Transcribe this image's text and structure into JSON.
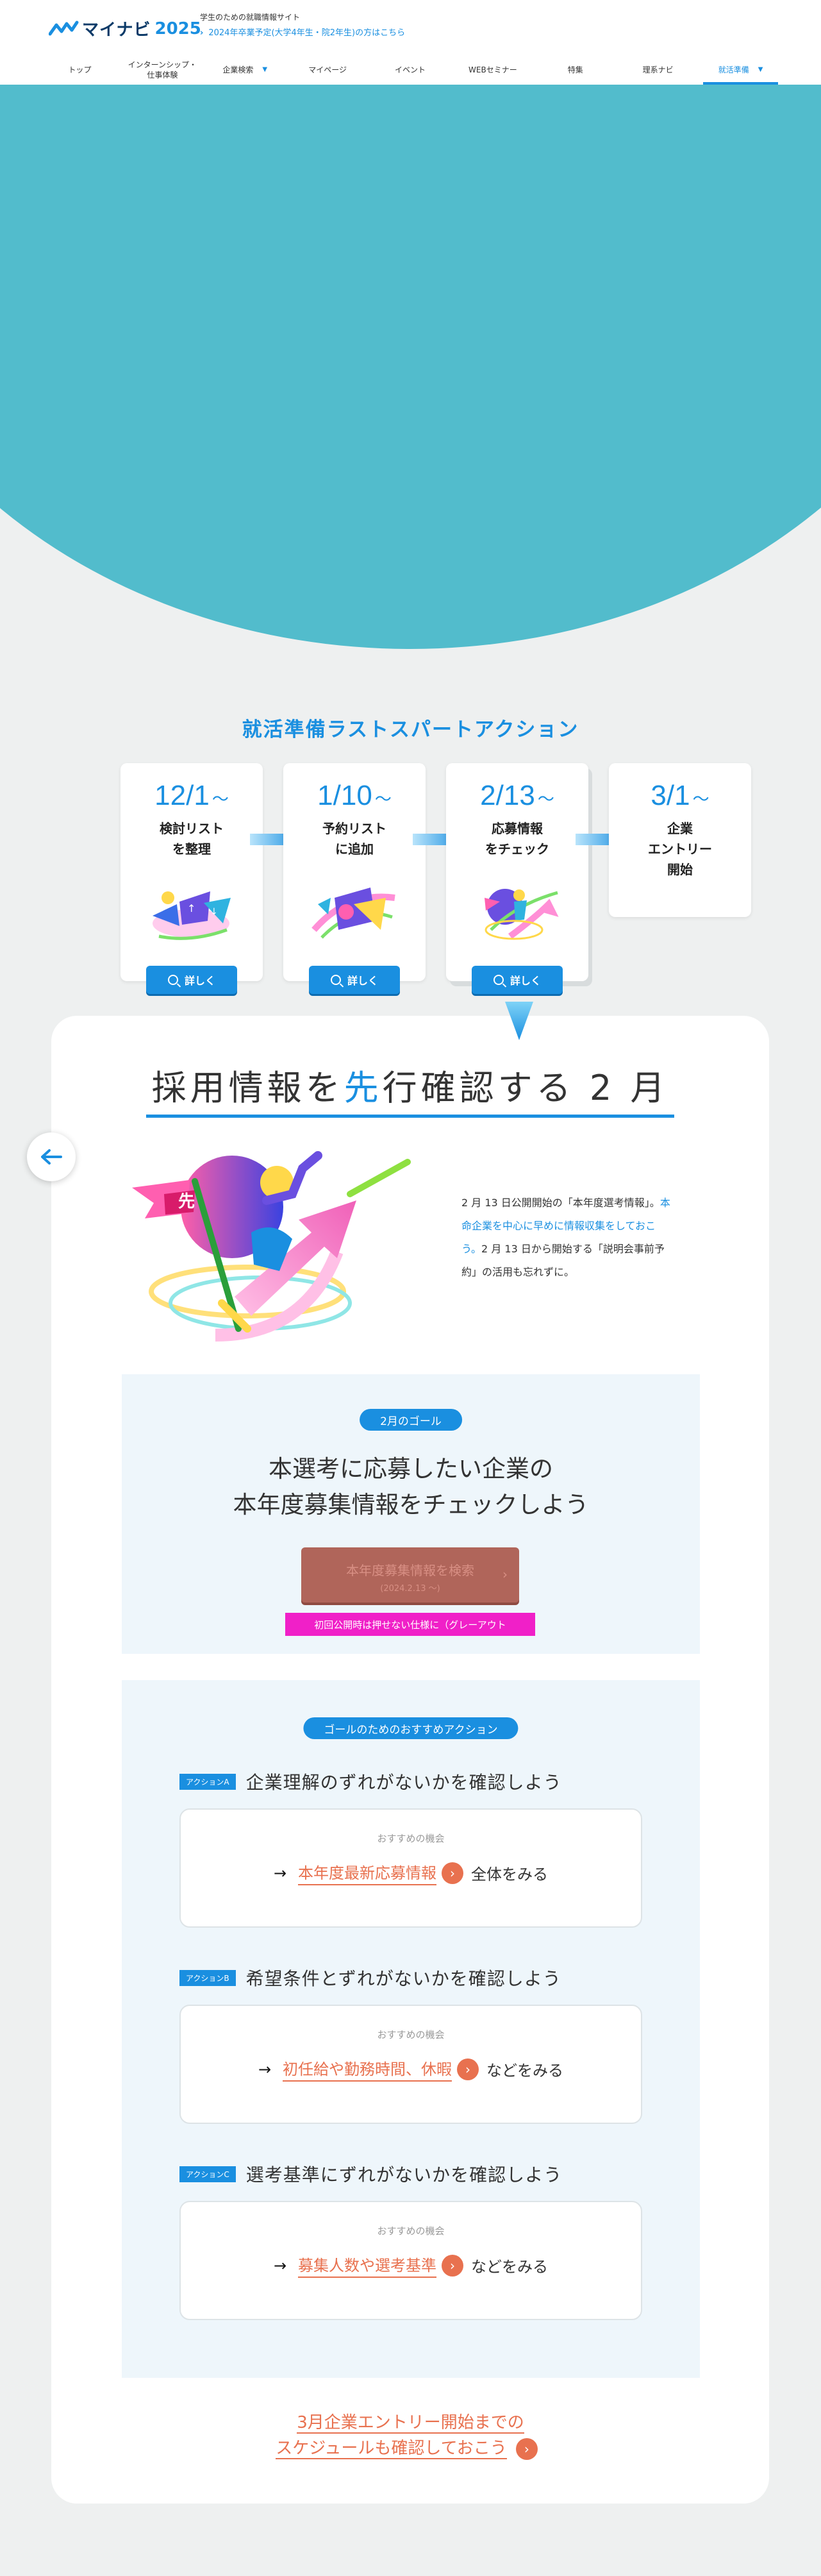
{
  "header": {
    "logo_text": "マイナビ",
    "logo_year": "2025",
    "tagline": "学生のための就職情報サイト",
    "notice": "2024年卒業予定(大学4年生・院2年生)の方はこちら",
    "nav": [
      {
        "label": "トップ"
      },
      {
        "label": "インターンシップ・\n仕事体験"
      },
      {
        "label": "企業検索"
      },
      {
        "label": "マイページ"
      },
      {
        "label": "イベント"
      },
      {
        "label": "WEBセミナー"
      },
      {
        "label": "特集"
      },
      {
        "label": "理系ナビ"
      },
      {
        "label": "就活準備"
      }
    ]
  },
  "colors": {
    "accent": "#1a8fe0",
    "hero": "#52bccc",
    "link": "#e8714f",
    "background": "#eef0f0"
  },
  "section_title": "就活準備ラストスパートアクション",
  "steps": [
    {
      "date": "12/1",
      "tilde": "～",
      "label": "検討リスト\nを整理",
      "button": "詳しく"
    },
    {
      "date": "1/10",
      "tilde": "～",
      "label": "予約リスト\nに追加",
      "button": "詳しく"
    },
    {
      "date": "2/13",
      "tilde": "～",
      "label": "応募情報\nをチェック",
      "button": "詳しく"
    },
    {
      "date": "3/1",
      "tilde": "～",
      "label": "企業\nエントリー\n開始"
    }
  ],
  "main": {
    "headline_a": "採用情報を",
    "headline_b": "先",
    "headline_c": "行確認する 2 月",
    "illus_badge": "先",
    "intro_a": "2 月 13 日公開開始の「本年度選考情報」。",
    "intro_b": "本命企業を中心に早めに情報収集をしておこう。",
    "intro_c": "2 月 13 日から開始する「説明会事前予約」の活用も忘れずに。"
  },
  "goal": {
    "pill": "2月のゴール",
    "text": "本選考に応募したい企業の\n本年度募集情報をチェックしよう",
    "button_main": "本年度募集情報を検索",
    "button_sub": "(2024.2.13 〜)",
    "button_chevron": "›",
    "note": "初回公開時は押せない仕様に（グレーアウト"
  },
  "actions": {
    "pill": "ゴールのためのおすすめアクション",
    "items": [
      {
        "tag": "アクションA",
        "title": "企業理解のずれがないかを確認しよう",
        "small": "おすすめの機会",
        "link": "本年度最新応募情報",
        "suffix": "全体をみる"
      },
      {
        "tag": "アクションB",
        "title": "希望条件とずれがないかを確認しよう",
        "small": "おすすめの機会",
        "link": "初任給や勤務時間、休暇",
        "suffix": "などをみる"
      },
      {
        "tag": "アクションC",
        "title": "選考基準にずれがないかを確認しよう",
        "small": "おすすめの機会",
        "link": "募集人数や選考基準",
        "suffix": "などをみる"
      }
    ],
    "arrow": "→",
    "chevron": "›"
  },
  "bottom_link": {
    "line1": "3月企業エントリー開始までの",
    "line2": "スケジュールも確認しておこう",
    "chevron": "›"
  }
}
